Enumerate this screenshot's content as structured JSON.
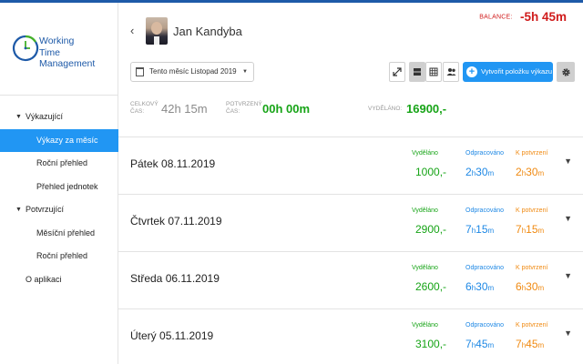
{
  "app": {
    "logo_lines": [
      "Working",
      "Time",
      "Management"
    ],
    "brand_color": "#1e5aa8",
    "accent_color": "#2196f3"
  },
  "sidebar": {
    "items": [
      {
        "label": "Výkazující",
        "kind": "section"
      },
      {
        "label": "Výkazy za měsíc",
        "kind": "sub",
        "active": true
      },
      {
        "label": "Roční přehled",
        "kind": "sub"
      },
      {
        "label": "Přehled jednotek",
        "kind": "sub"
      },
      {
        "label": "Potvrzující",
        "kind": "section"
      },
      {
        "label": "Měsíční přehled",
        "kind": "sub"
      },
      {
        "label": "Roční přehled",
        "kind": "sub"
      },
      {
        "label": "O aplikaci",
        "kind": "plain"
      }
    ]
  },
  "header": {
    "back_icon": "‹",
    "user_name": "Jan Kandyba",
    "balance_label": "BALANCE:",
    "balance_value": "-5h 45m",
    "balance_color": "#d01c1c"
  },
  "toolbar": {
    "month_select_value": "Tento měsíc  Listopad 2019",
    "create_label": "Vytvořit položku výkazu"
  },
  "stats": {
    "total_label": [
      "CELKOVÝ",
      "ČAS:"
    ],
    "total_value": "42h 15m",
    "confirmed_label": [
      "POTVRZENÝ",
      "ČAS:"
    ],
    "confirmed_value": "00h 00m",
    "earned_label": "VYDĚLÁNO:",
    "earned_value": "16900,-"
  },
  "columns": {
    "earned": "Vyděláno",
    "worked": "Odpracováno",
    "pending": "K potvrzení"
  },
  "days": [
    {
      "weekday": "Pátek",
      "date": "08.11.2019",
      "earned": "1000,-",
      "worked_h": "2",
      "worked_m": "30",
      "pending_h": "2",
      "pending_m": "30"
    },
    {
      "weekday": "Čtvrtek",
      "date": "07.11.2019",
      "earned": "2900,-",
      "worked_h": "7",
      "worked_m": "15",
      "pending_h": "7",
      "pending_m": "15"
    },
    {
      "weekday": "Středa",
      "date": "06.11.2019",
      "earned": "2600,-",
      "worked_h": "6",
      "worked_m": "30",
      "pending_h": "6",
      "pending_m": "30"
    },
    {
      "weekday": "Úterý",
      "date": "05.11.2019",
      "earned": "3100,-",
      "worked_h": "7",
      "worked_m": "45",
      "pending_h": "7",
      "pending_m": "45"
    }
  ],
  "units": {
    "h": "h",
    "m": "m"
  }
}
